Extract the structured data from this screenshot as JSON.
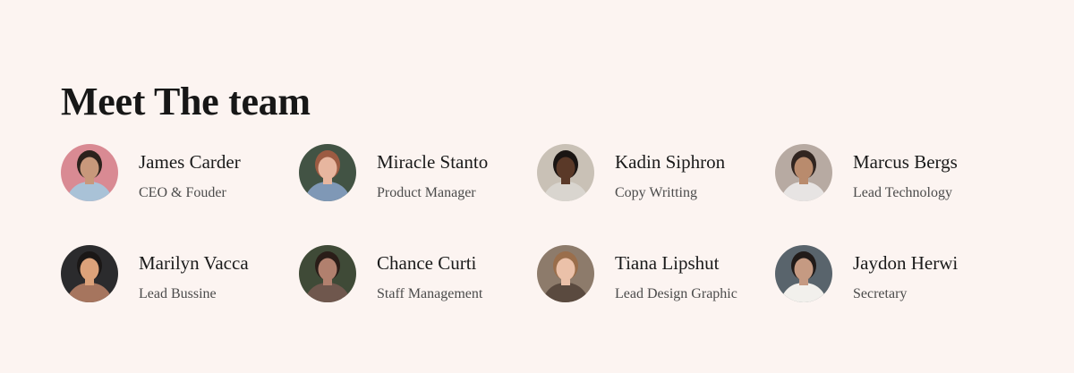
{
  "section": {
    "title": "Meet The team"
  },
  "team": [
    {
      "name": "James Carder",
      "role": "CEO & Fouder",
      "avatar_bg": "#d98a93",
      "avatar_skin": "#c8987b",
      "avatar_hair": "#2c211c",
      "avatar_shirt": "#a9c2d7"
    },
    {
      "name": "Miracle Stanto",
      "role": "Product Manager",
      "avatar_bg": "#425344",
      "avatar_skin": "#e7b69f",
      "avatar_hair": "#9c5b42",
      "avatar_shirt": "#7f98b6"
    },
    {
      "name": "Kadin Siphron",
      "role": "Copy Writting",
      "avatar_bg": "#c9c1b6",
      "avatar_skin": "#5a3928",
      "avatar_hair": "#1a1513",
      "avatar_shirt": "#d9d5cf"
    },
    {
      "name": "Marcus Bergs",
      "role": "Lead Technology",
      "avatar_bg": "#b7aaa2",
      "avatar_skin": "#b98b6d",
      "avatar_hair": "#312520",
      "avatar_shirt": "#e7e4e3"
    },
    {
      "name": "Marilyn Vacca",
      "role": "Lead Bussine",
      "avatar_bg": "#2b2b2d",
      "avatar_skin": "#dca27a",
      "avatar_hair": "#1a1716",
      "avatar_shirt": "#a6755e"
    },
    {
      "name": "Chance Curti",
      "role": "Staff Management",
      "avatar_bg": "#3f4a37",
      "avatar_skin": "#b1806e",
      "avatar_hair": "#2a1d18",
      "avatar_shirt": "#6f574d"
    },
    {
      "name": "Tiana Lipshut",
      "role": "Lead Design Graphic",
      "avatar_bg": "#8d7b6b",
      "avatar_skin": "#ebc1a9",
      "avatar_hair": "#9a6e4b",
      "avatar_shirt": "#5a4a3f"
    },
    {
      "name": "Jaydon Herwi",
      "role": "Secretary",
      "avatar_bg": "#59646c",
      "avatar_skin": "#c59a82",
      "avatar_hair": "#211b19",
      "avatar_shirt": "#f2f0ec"
    }
  ]
}
